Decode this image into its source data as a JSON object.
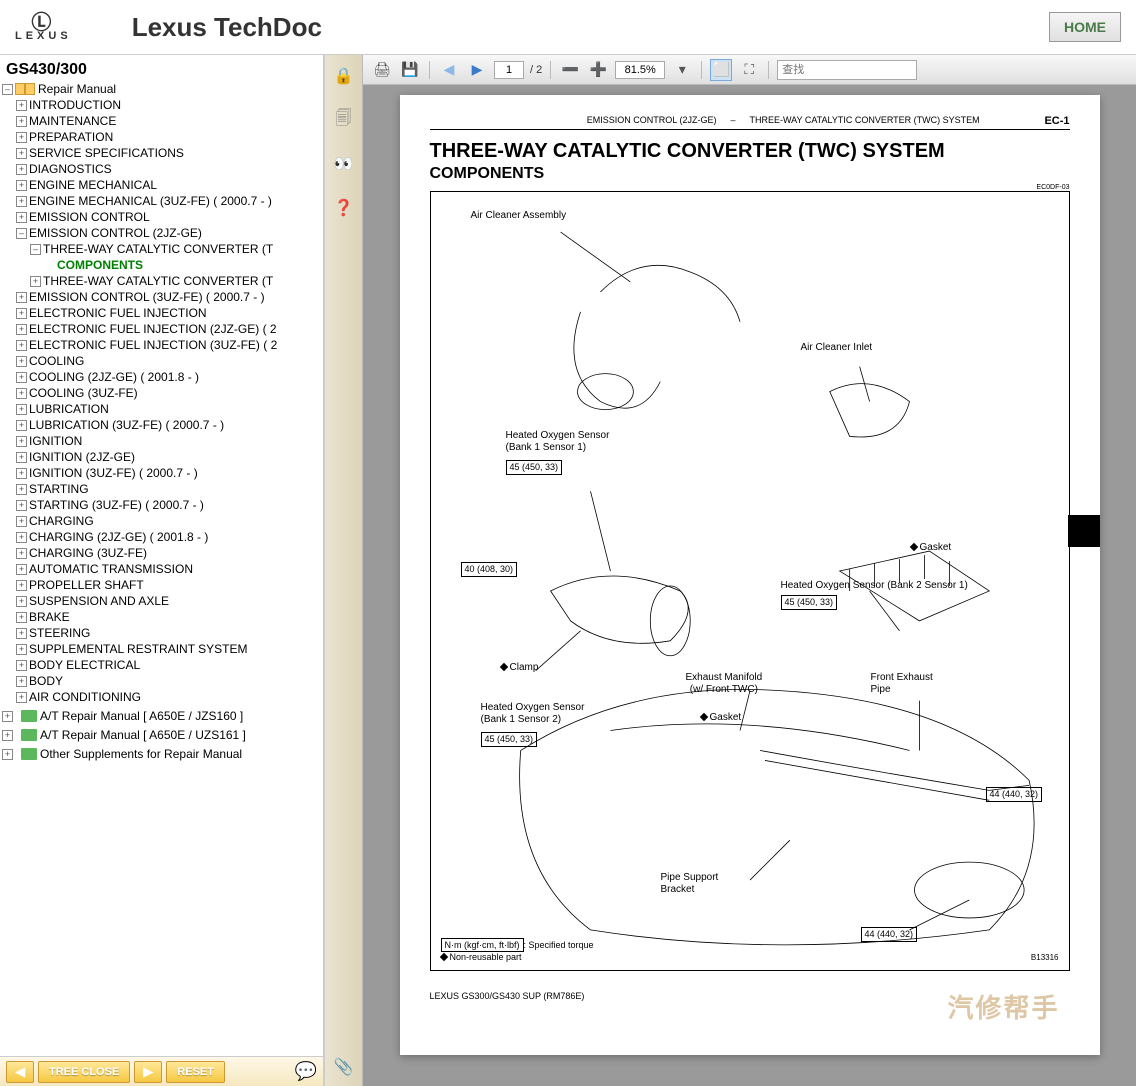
{
  "header": {
    "brand": "LEXUS",
    "app_title": "Lexus TechDoc",
    "home": "HOME"
  },
  "sidebar": {
    "model": "GS430/300",
    "root": "Repair Manual",
    "nodes": [
      {
        "label": "INTRODUCTION",
        "toggle": "+",
        "indent": 1
      },
      {
        "label": "MAINTENANCE",
        "toggle": "+",
        "indent": 1
      },
      {
        "label": "PREPARATION",
        "toggle": "+",
        "indent": 1
      },
      {
        "label": "SERVICE SPECIFICATIONS",
        "toggle": "+",
        "indent": 1
      },
      {
        "label": "DIAGNOSTICS",
        "toggle": "+",
        "indent": 1
      },
      {
        "label": "ENGINE MECHANICAL",
        "toggle": "+",
        "indent": 1
      },
      {
        "label": "ENGINE MECHANICAL (3UZ-FE) ( 2000.7 - )",
        "toggle": "+",
        "indent": 1
      },
      {
        "label": "EMISSION CONTROL",
        "toggle": "+",
        "indent": 1
      },
      {
        "label": "EMISSION CONTROL (2JZ-GE)",
        "toggle": "–",
        "indent": 1
      },
      {
        "label": "THREE-WAY CATALYTIC CONVERTER (T",
        "toggle": "–",
        "indent": 2
      },
      {
        "label": "COMPONENTS",
        "toggle": "",
        "indent": 3,
        "selected": true
      },
      {
        "label": "THREE-WAY CATALYTIC CONVERTER (T",
        "toggle": "+",
        "indent": 2
      },
      {
        "label": "EMISSION CONTROL (3UZ-FE) ( 2000.7 - )",
        "toggle": "+",
        "indent": 1
      },
      {
        "label": "ELECTRONIC FUEL INJECTION",
        "toggle": "+",
        "indent": 1
      },
      {
        "label": "ELECTRONIC FUEL INJECTION (2JZ-GE) ( 2",
        "toggle": "+",
        "indent": 1
      },
      {
        "label": "ELECTRONIC FUEL INJECTION (3UZ-FE) ( 2",
        "toggle": "+",
        "indent": 1
      },
      {
        "label": "COOLING",
        "toggle": "+",
        "indent": 1
      },
      {
        "label": "COOLING (2JZ-GE) ( 2001.8 - )",
        "toggle": "+",
        "indent": 1
      },
      {
        "label": "COOLING (3UZ-FE)",
        "toggle": "+",
        "indent": 1
      },
      {
        "label": "LUBRICATION",
        "toggle": "+",
        "indent": 1
      },
      {
        "label": "LUBRICATION (3UZ-FE) ( 2000.7 - )",
        "toggle": "+",
        "indent": 1
      },
      {
        "label": "IGNITION",
        "toggle": "+",
        "indent": 1
      },
      {
        "label": "IGNITION (2JZ-GE)",
        "toggle": "+",
        "indent": 1
      },
      {
        "label": "IGNITION (3UZ-FE) ( 2000.7 - )",
        "toggle": "+",
        "indent": 1
      },
      {
        "label": "STARTING",
        "toggle": "+",
        "indent": 1
      },
      {
        "label": "STARTING (3UZ-FE) ( 2000.7 - )",
        "toggle": "+",
        "indent": 1
      },
      {
        "label": "CHARGING",
        "toggle": "+",
        "indent": 1
      },
      {
        "label": "CHARGING (2JZ-GE) ( 2001.8 - )",
        "toggle": "+",
        "indent": 1
      },
      {
        "label": "CHARGING (3UZ-FE)",
        "toggle": "+",
        "indent": 1
      },
      {
        "label": "AUTOMATIC TRANSMISSION",
        "toggle": "+",
        "indent": 1
      },
      {
        "label": "PROPELLER SHAFT",
        "toggle": "+",
        "indent": 1
      },
      {
        "label": "SUSPENSION AND AXLE",
        "toggle": "+",
        "indent": 1
      },
      {
        "label": "BRAKE",
        "toggle": "+",
        "indent": 1
      },
      {
        "label": "STEERING",
        "toggle": "+",
        "indent": 1
      },
      {
        "label": "SUPPLEMENTAL RESTRAINT SYSTEM",
        "toggle": "+",
        "indent": 1
      },
      {
        "label": "BODY ELECTRICAL",
        "toggle": "+",
        "indent": 1
      },
      {
        "label": "BODY",
        "toggle": "+",
        "indent": 1
      },
      {
        "label": "AIR CONDITIONING",
        "toggle": "+",
        "indent": 1
      }
    ],
    "books": [
      {
        "label": "A/T Repair Manual [ A650E / JZS160 ]"
      },
      {
        "label": "A/T Repair Manual [ A650E / UZS161 ]"
      },
      {
        "label": "Other Supplements for Repair Manual"
      }
    ],
    "footer": {
      "tree_close": "TREE CLOSE",
      "reset": "RESET"
    }
  },
  "pdf_toolbar": {
    "page": "1",
    "page_total": "/ 2",
    "zoom": "81.5%",
    "search_placeholder": "查找"
  },
  "document": {
    "header_left": "EMISSION CONTROL (2JZ-GE)",
    "header_sep": "–",
    "header_mid": "THREE-WAY CATALYTIC CONVERTER (TWC) SYSTEM",
    "header_right": "EC-1",
    "code_tr": "EC0DF-03",
    "title": "THREE-WAY CATALYTIC CONVERTER (TWC) SYSTEM",
    "subtitle": "COMPONENTS",
    "labels": {
      "air_cleaner_assembly": "Air Cleaner Assembly",
      "air_cleaner_inlet": "Air Cleaner Inlet",
      "ho2s_b1s1": "Heated Oxygen Sensor\n(Bank 1 Sensor 1)",
      "torque_45a": "45 (450, 33)",
      "torque_40": "40 (408, 30)",
      "gasket1": "Gasket",
      "ho2s_b2s1": "Heated Oxygen Sensor (Bank 2 Sensor 1)",
      "torque_45b": "45 (450, 33)",
      "clamp": "Clamp",
      "exhaust_manifold": "Exhaust Manifold\n(w/ Front TWC)",
      "front_exhaust_pipe": "Front Exhaust\nPipe",
      "ho2s_b1s2": "Heated Oxygen Sensor\n(Bank 1 Sensor 2)",
      "torque_45c": "45 (450, 33)",
      "gasket2": "Gasket",
      "torque_44a": "44 (440, 32)",
      "pipe_support": "Pipe Support\nBracket",
      "torque_44b": "44 (440, 32)",
      "nm_box": "N·m (kgf·cm, ft·lbf)",
      "nm_note": ": Specified torque",
      "nonreusable": "Non-reusable part",
      "bottom_code": "B13316"
    },
    "footer": "LEXUS GS300/GS430 SUP   (RM786E)"
  },
  "watermark": "汽修帮手"
}
